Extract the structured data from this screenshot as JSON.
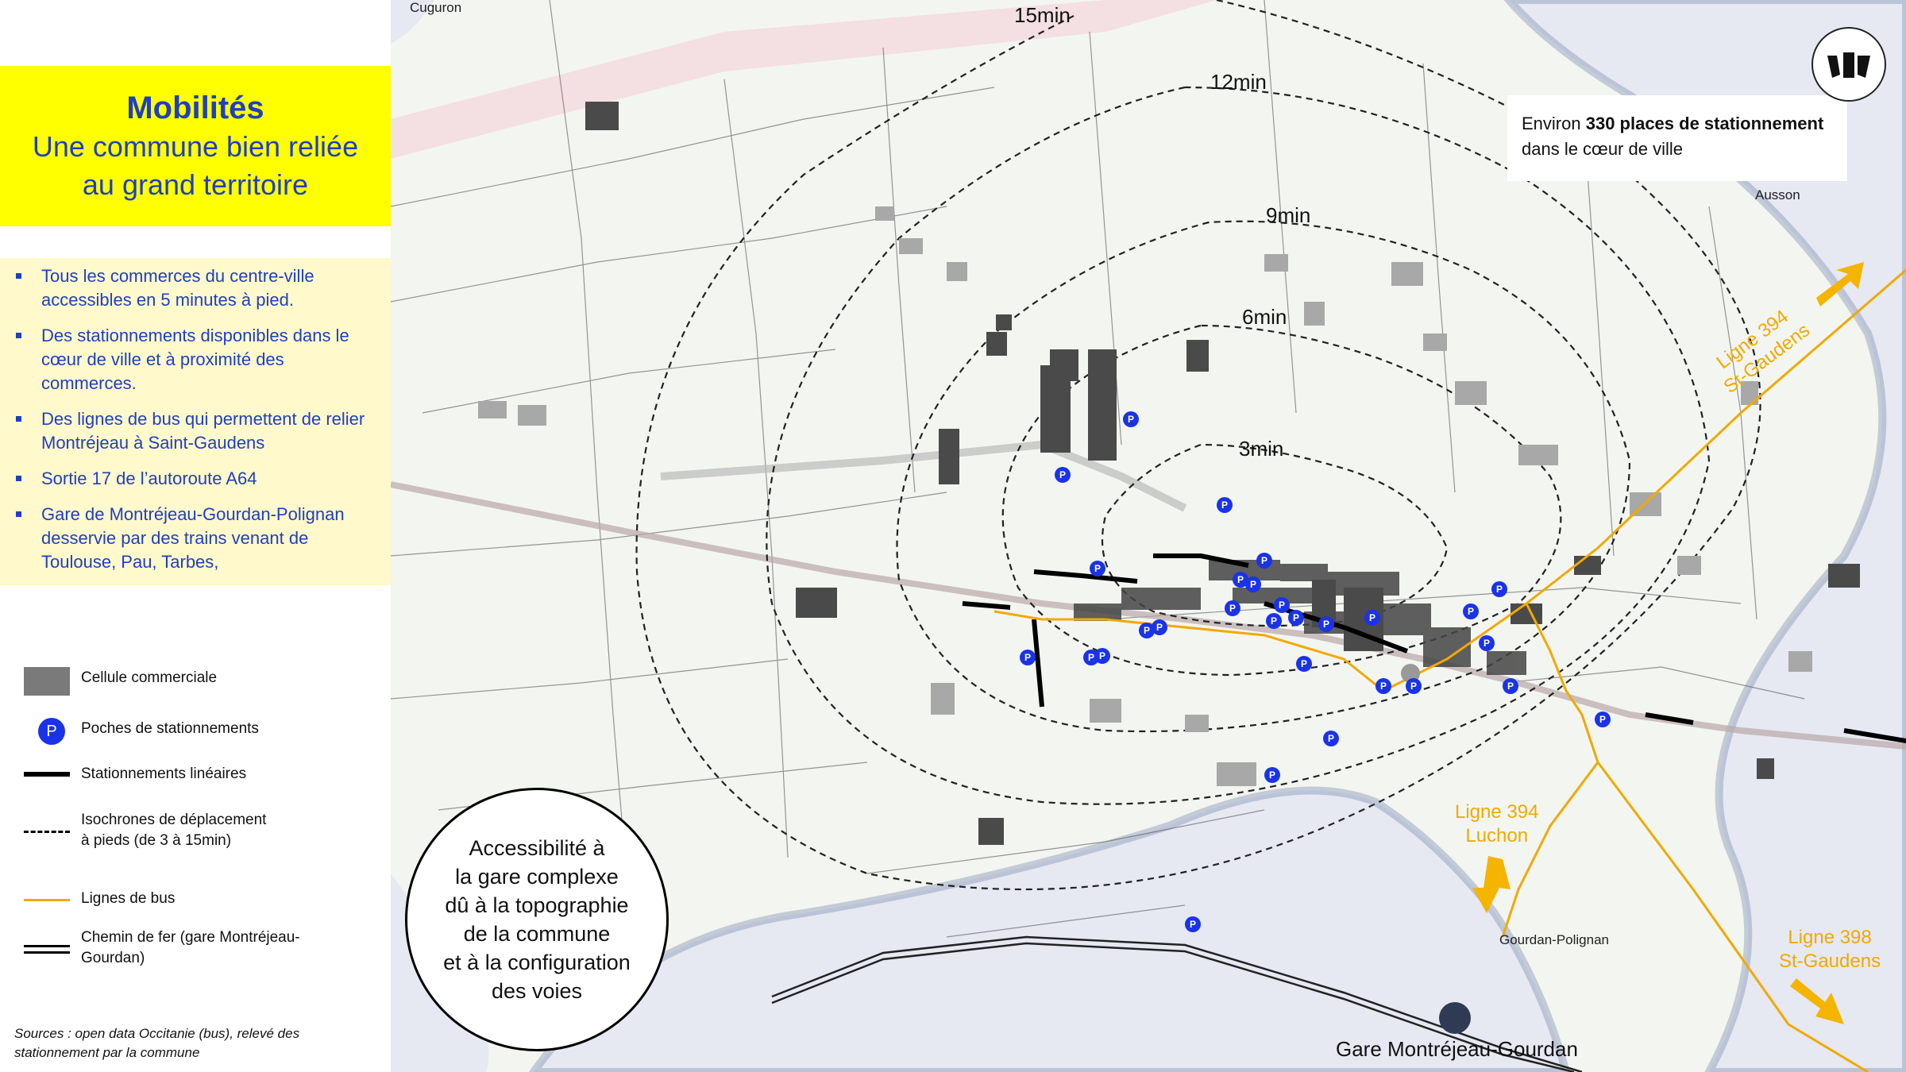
{
  "title": {
    "main": "Mobilités",
    "sub_line1": "Une commune bien reliée",
    "sub_line2": "au grand territoire"
  },
  "bullets": [
    "Tous les commerces du centre-ville accessibles en 5 minutes à pied.",
    "Des stationnements disponibles dans le cœur de ville et à proximité des commerces.",
    "Des lignes de bus qui permettent de relier Montréjeau à Saint-Gaudens",
    "Sortie 17 de l’autoroute A64",
    "Gare de Montréjeau-Gourdan-Polignan desservie par des trains venant de Toulouse, Pau, Tarbes,"
  ],
  "legend": [
    {
      "symbol": "cell",
      "label": "Cellule commerciale"
    },
    {
      "symbol": "parking",
      "label": "Poches de stationnements",
      "glyph": "P"
    },
    {
      "symbol": "solid-line",
      "label": "Stationnements linéaires"
    },
    {
      "symbol": "dashed-line",
      "label_line1": "Isochrones de déplacement",
      "label_line2": "à pieds (de 3 à 15min)"
    },
    {
      "symbol": "bus-line",
      "label": "Lignes de bus"
    },
    {
      "symbol": "rail",
      "label_line1": "Chemin de fer (gare Montréjeau-",
      "label_line2": "Gourdan)"
    }
  ],
  "sources": {
    "line1": "Sources : open data Occitanie (bus), relevé des",
    "line2": "stationnement par la commune"
  },
  "map": {
    "isochrones": [
      "15min",
      "12min",
      "9min",
      "6min",
      "3min"
    ],
    "places": {
      "cuguron": "Cuguron",
      "ausson": "Ausson",
      "gourdan": "Gourdan-Polignan"
    },
    "bus_lines": {
      "st_gaudens_394": {
        "line1": "Ligne 394",
        "line2": "St-Gaudens"
      },
      "luchon_394": {
        "line1": "Ligne 394",
        "line2": "Luchon"
      },
      "st_gaudens_398": {
        "line1": "Ligne 398",
        "line2": "St-Gaudens"
      }
    },
    "parking_info": {
      "prefix": "Environ ",
      "bold": "330 places de stationnement",
      "suffix": " dans le cœur de ville"
    },
    "access_bubble": {
      "line1": "Accessibilité à",
      "line2": "la gare complexe",
      "line3": "dû à la topographie",
      "line4": "de la commune",
      "line5": "et à la configuration",
      "line6": "des voies"
    },
    "gare": "Gare Montréjeau-Gourdan",
    "parking_glyph": "P"
  },
  "colors": {
    "title_bg": "#ffff00",
    "title_text": "#1f3fc2",
    "bullets_bg": "#fff9cc",
    "parking_blue": "#1a33e8",
    "bus_orange": "#f2a900",
    "commercial_cell": "#7a7a7a",
    "water_shadow": "#6a7fa6"
  }
}
